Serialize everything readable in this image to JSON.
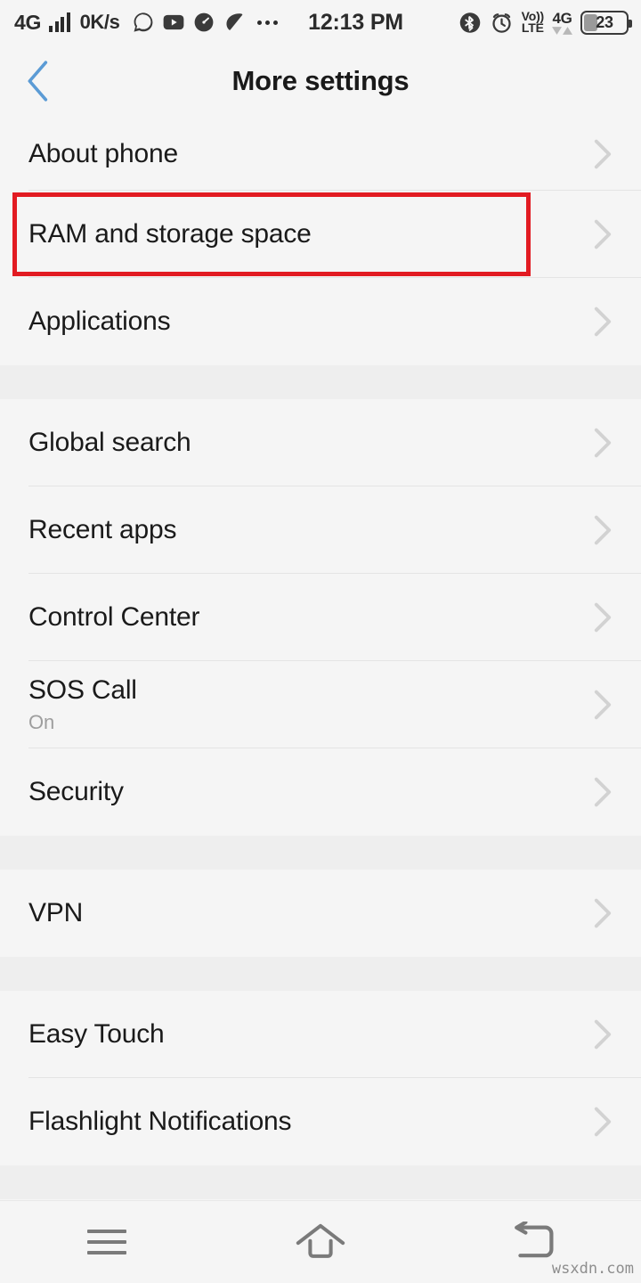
{
  "status_bar": {
    "network_type": "4G",
    "data_speed": "0K/s",
    "time": "12:13 PM",
    "volte_top": "Vo))",
    "volte_bottom": "LTE",
    "sim_network": "4G",
    "battery_percent": "23",
    "battery_level": 30,
    "signal_bars": 4,
    "notification_icons": [
      "whatsapp-icon",
      "youtube-icon",
      "clock-app-icon",
      "leaf-app-icon"
    ],
    "overflow_indicator": "…",
    "right_icons": [
      "bluetooth-icon",
      "alarm-icon",
      "volte-icon",
      "sim-signal-icon",
      "battery-icon"
    ]
  },
  "header": {
    "title": "More settings",
    "back_icon": "chevron-left-icon",
    "back_color": "#5b9bd5"
  },
  "annotation": {
    "highlight_color": "#e21b22",
    "highlighted_row": "RAM and storage space"
  },
  "list": {
    "chevron_icon": "chevron-right-icon",
    "groups": [
      {
        "items": [
          {
            "label": "About phone",
            "sub": null,
            "highlighted": false
          },
          {
            "label": "RAM and storage space",
            "sub": null,
            "highlighted": true
          },
          {
            "label": "Applications",
            "sub": null,
            "highlighted": false
          }
        ]
      },
      {
        "items": [
          {
            "label": "Global search",
            "sub": null,
            "highlighted": false
          },
          {
            "label": "Recent apps",
            "sub": null,
            "highlighted": false
          },
          {
            "label": "Control Center",
            "sub": null,
            "highlighted": false
          },
          {
            "label": "SOS Call",
            "sub": "On",
            "highlighted": false
          },
          {
            "label": "Security",
            "sub": null,
            "highlighted": false
          }
        ]
      },
      {
        "items": [
          {
            "label": "VPN",
            "sub": null,
            "highlighted": false
          }
        ]
      },
      {
        "items": [
          {
            "label": "Easy Touch",
            "sub": null,
            "highlighted": false
          },
          {
            "label": "Flashlight Notifications",
            "sub": null,
            "highlighted": false
          }
        ]
      }
    ]
  },
  "navbar": {
    "buttons": [
      {
        "name": "menu-button",
        "icon": "hamburger-icon"
      },
      {
        "name": "home-button",
        "icon": "home-icon"
      },
      {
        "name": "back-button",
        "icon": "return-arrow-icon"
      }
    ]
  },
  "watermark": {
    "text": "wsxdn.com"
  }
}
